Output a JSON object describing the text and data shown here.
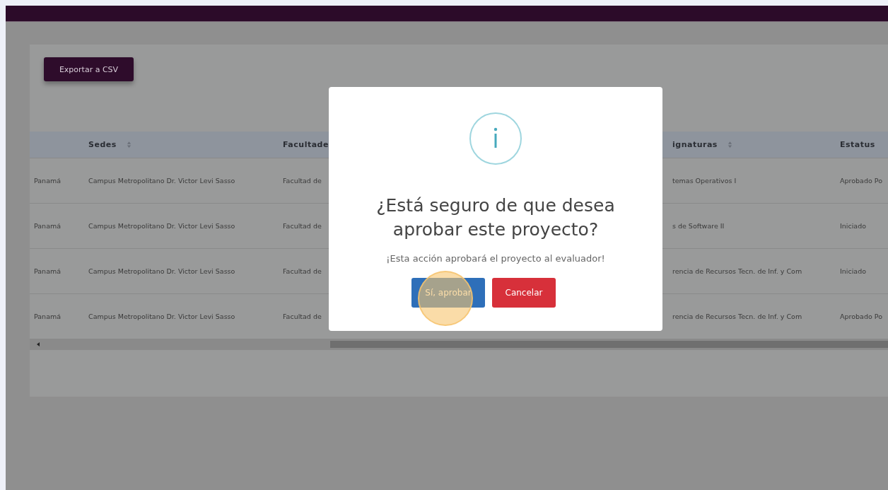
{
  "export_button": {
    "label": "Exportar a CSV"
  },
  "table": {
    "columns": [
      {
        "label": "Sedes",
        "sortable": true
      },
      {
        "label": "Facultade"
      },
      {
        "label": "ignaturas",
        "sortable": true
      },
      {
        "label": "Estatus",
        "sortable": false
      }
    ],
    "rows": [
      {
        "column_1": "Panamá",
        "cells": [
          "Campus Metropolitano Dr. Victor Levi Sasso",
          "Facultad de",
          "temas Operativos I",
          "Aprobado Po"
        ]
      },
      {
        "column_1": "Panamá",
        "cells": [
          "Campus Metropolitano Dr. Victor Levi Sasso",
          "Facultad de",
          "s de Software II",
          "Iniciado"
        ]
      },
      {
        "column_1": "Panamá",
        "cells": [
          "Campus Metropolitano Dr. Victor Levi Sasso",
          "Facultad de",
          "rencia de Recursos Tecn. de Inf. y Com",
          "Iniciado"
        ]
      },
      {
        "column_1": "Panamá",
        "cells": [
          "Campus Metropolitano Dr. Victor Levi Sasso",
          "Facultad de",
          "rencia de Recursos Tecn. de Inf. y Com",
          "Aprobado Po"
        ]
      }
    ]
  },
  "dialog": {
    "title": "¿Está seguro de que desea aprobar este proyecto?",
    "message": "¡Esta acción aprobará el proyecto al evaluador!",
    "buttons": [
      {
        "label": "Sí, aprobar",
        "kind": "confirm"
      },
      {
        "label": "Cancelar",
        "kind": "cancel"
      }
    ]
  }
}
